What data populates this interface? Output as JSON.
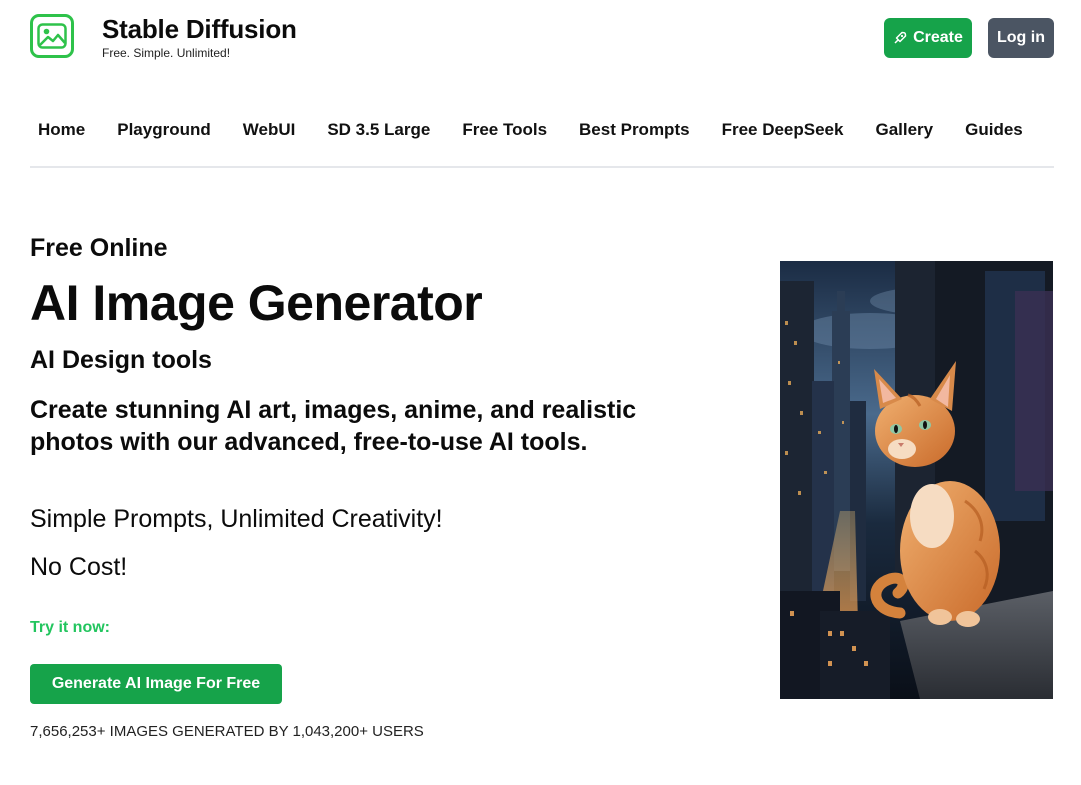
{
  "header": {
    "brand_title": "Stable Diffusion",
    "brand_tagline": "Free. Simple. Unlimited!",
    "logo_icon": "image-icon",
    "create_label": "Create",
    "create_icon": "rocket-icon",
    "login_label": "Log in"
  },
  "nav": {
    "items": [
      {
        "label": "Home"
      },
      {
        "label": "Playground"
      },
      {
        "label": "WebUI"
      },
      {
        "label": "SD 3.5 Large"
      },
      {
        "label": "Free Tools"
      },
      {
        "label": "Best Prompts"
      },
      {
        "label": "Free DeepSeek"
      },
      {
        "label": "Gallery"
      },
      {
        "label": "Guides"
      }
    ]
  },
  "hero": {
    "pre_title": "Free Online",
    "title": "AI Image Generator",
    "subtitle": "AI Design tools",
    "description": "Create stunning AI art, images, anime, and realistic photos with our advanced, free-to-use AI tools.",
    "line1": "Simple Prompts, Unlimited Creativity!",
    "line2": "No Cost!",
    "try_now": "Try it now:",
    "cta_label": "Generate AI Image For Free",
    "stats": "7,656,253+ IMAGES GENERATED BY 1,043,200+ USERS"
  },
  "colors": {
    "brand_green": "#16a34a",
    "accent_green": "#22c55e",
    "logo_green": "#2ec24a",
    "login_gray": "#4b5563"
  }
}
